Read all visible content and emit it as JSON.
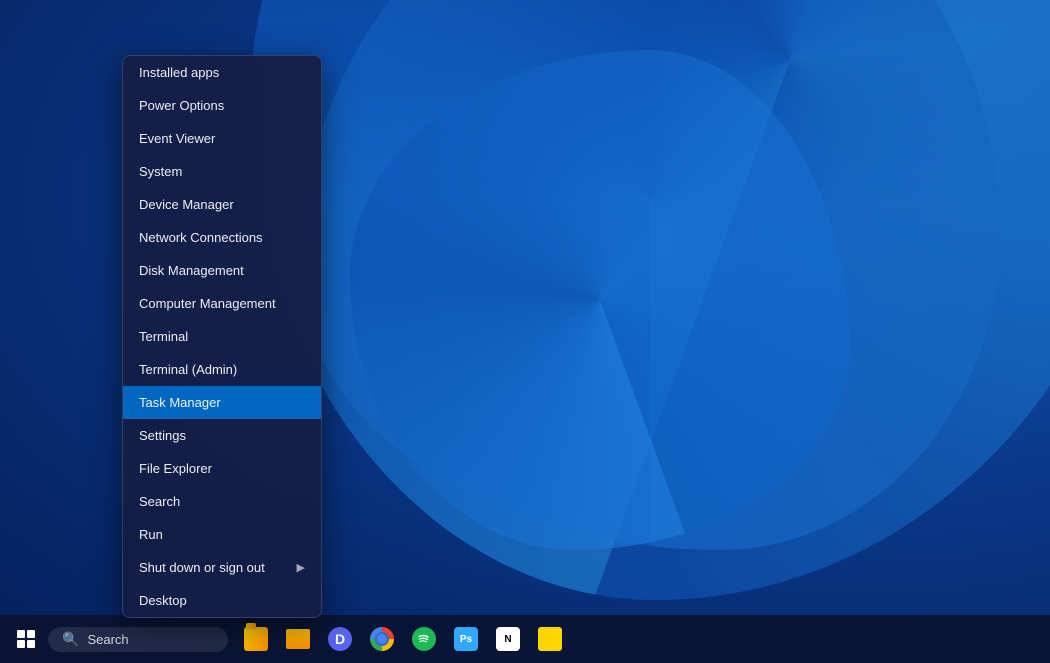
{
  "desktop": {
    "bg_color": "#0a3a8c"
  },
  "context_menu": {
    "items": [
      {
        "id": "installed-apps",
        "label": "Installed apps",
        "has_arrow": false,
        "active": false
      },
      {
        "id": "power-options",
        "label": "Power Options",
        "has_arrow": false,
        "active": false
      },
      {
        "id": "event-viewer",
        "label": "Event Viewer",
        "has_arrow": false,
        "active": false
      },
      {
        "id": "system",
        "label": "System",
        "has_arrow": false,
        "active": false
      },
      {
        "id": "device-manager",
        "label": "Device Manager",
        "has_arrow": false,
        "active": false
      },
      {
        "id": "network-connections",
        "label": "Network Connections",
        "has_arrow": false,
        "active": false
      },
      {
        "id": "disk-management",
        "label": "Disk Management",
        "has_arrow": false,
        "active": false
      },
      {
        "id": "computer-management",
        "label": "Computer Management",
        "has_arrow": false,
        "active": false
      },
      {
        "id": "terminal",
        "label": "Terminal",
        "has_arrow": false,
        "active": false
      },
      {
        "id": "terminal-admin",
        "label": "Terminal (Admin)",
        "has_arrow": false,
        "active": false
      },
      {
        "id": "task-manager",
        "label": "Task Manager",
        "has_arrow": false,
        "active": true
      },
      {
        "id": "settings",
        "label": "Settings",
        "has_arrow": false,
        "active": false
      },
      {
        "id": "file-explorer",
        "label": "File Explorer",
        "has_arrow": false,
        "active": false
      },
      {
        "id": "search",
        "label": "Search",
        "has_arrow": false,
        "active": false
      },
      {
        "id": "run",
        "label": "Run",
        "has_arrow": false,
        "active": false
      },
      {
        "id": "shut-down",
        "label": "Shut down or sign out",
        "has_arrow": true,
        "active": false
      },
      {
        "id": "desktop",
        "label": "Desktop",
        "has_arrow": false,
        "active": false
      }
    ]
  },
  "taskbar": {
    "search_placeholder": "Search",
    "apps": [
      {
        "id": "file-manager",
        "name": "File Manager",
        "type": "files"
      },
      {
        "id": "folder",
        "name": "File Explorer",
        "type": "folder"
      },
      {
        "id": "discord",
        "name": "Discord",
        "type": "discord"
      },
      {
        "id": "chrome",
        "name": "Google Chrome",
        "type": "chrome"
      },
      {
        "id": "spotify",
        "name": "Spotify",
        "type": "spotify"
      },
      {
        "id": "photoshop",
        "name": "Photoshop",
        "type": "ps"
      },
      {
        "id": "notion",
        "name": "Notion",
        "type": "notion"
      },
      {
        "id": "notes",
        "name": "Notes",
        "type": "notes"
      }
    ]
  }
}
